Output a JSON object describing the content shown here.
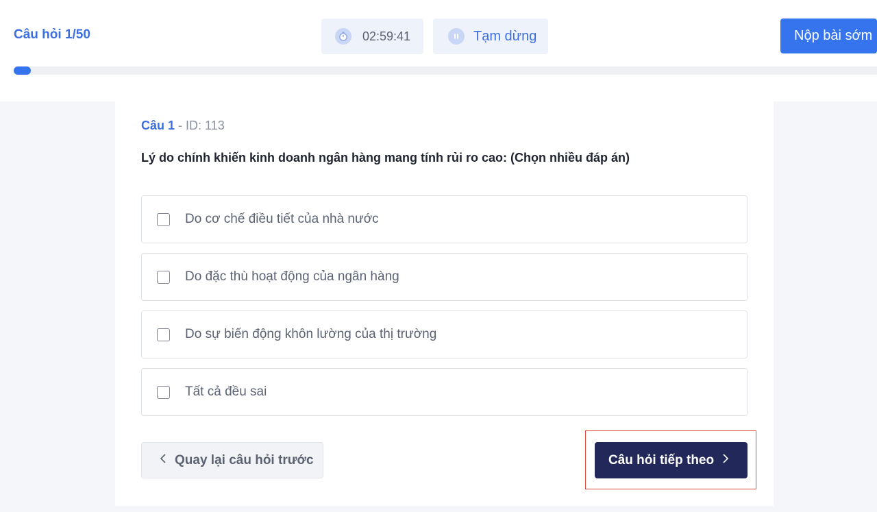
{
  "header": {
    "question_counter": "Câu hỏi 1/50",
    "timer": {
      "icon": "stopwatch-icon",
      "value": "02:59:41"
    },
    "pause": {
      "icon": "pause-icon",
      "label": "Tạm dừng"
    },
    "submit_label": "Nộp bài sớm",
    "progress": {
      "current": 1,
      "total": 50
    }
  },
  "question": {
    "number_label": "Câu 1",
    "separator": " - ",
    "id_label": "ID: 113",
    "text": "Lý do chính khiến kinh doanh ngân hàng mang tính rủi ro cao: (Chọn nhiều đáp án)",
    "options": [
      {
        "label": "Do cơ chế điều tiết của nhà nước",
        "checked": false
      },
      {
        "label": "Do đặc thù hoạt động của ngân hàng",
        "checked": false
      },
      {
        "label": "Do sự biến động khôn lường của thị trường",
        "checked": false
      },
      {
        "label": "Tất cả đều sai",
        "checked": false
      }
    ]
  },
  "navigation": {
    "prev_label": "Quay lại câu hỏi trước",
    "next_label": "Câu hỏi tiếp theo"
  },
  "colors": {
    "accent": "#3574ed",
    "next_button": "#22295a",
    "highlight_border": "#e0483c"
  }
}
